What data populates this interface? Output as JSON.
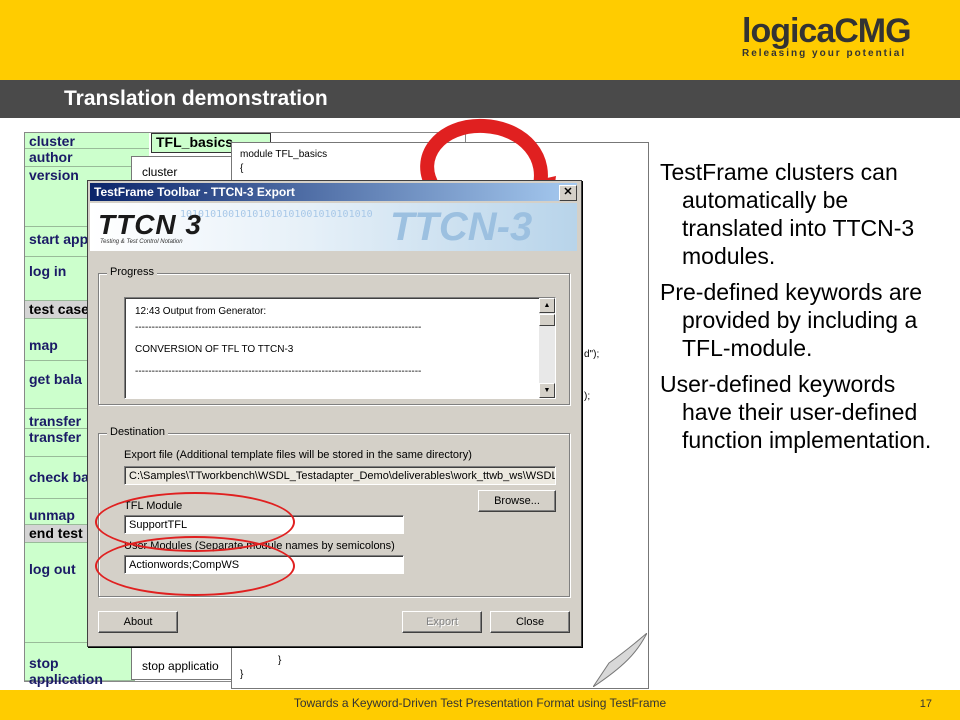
{
  "slide": {
    "title": "Translation demonstration",
    "footer": "Towards a Keyword-Driven Test Presentation Format using TestFrame",
    "page_number": "17",
    "logo": {
      "word": "logicaCMG",
      "tagline": "Releasing your potential"
    }
  },
  "bullets": [
    "TestFrame clusters can automatically be translated into TTCN-3 modules.",
    "Pre-defined keywords are provided by including a TFL-module.",
    "User-defined keywords have their user-defined function implementation."
  ],
  "spreadsheet": {
    "header_cell": "TFL_basics",
    "rows": [
      {
        "label": "cluster",
        "style": "green"
      },
      {
        "label": "author",
        "style": "green"
      },
      {
        "label": "version",
        "style": "green"
      },
      {
        "label": "start appl",
        "style": "green"
      },
      {
        "label": "log in",
        "style": "green"
      },
      {
        "label": "test case",
        "style": "gray"
      },
      {
        "label": "map",
        "style": "green"
      },
      {
        "label": "get bala",
        "style": "green"
      },
      {
        "label": "transfer",
        "style": "green"
      },
      {
        "label": "transfer",
        "style": "green"
      },
      {
        "label": "check ba",
        "style": "green"
      },
      {
        "label": "unmap",
        "style": "green"
      },
      {
        "label": "end test",
        "style": "gray"
      },
      {
        "label": "log out",
        "style": "green"
      },
      {
        "label": "stop application",
        "style": "green"
      }
    ]
  },
  "doc1": {
    "top": "cluster",
    "bottom": "stop applicatio"
  },
  "doc2": {
    "module": "module TFL_basics",
    "brace": "{",
    "frag1": "d\");",
    "frag2": ");",
    "end_inner": "}",
    "end_outer": "}"
  },
  "dialog": {
    "title": "TestFrame Toolbar - TTCN-3 Export",
    "close_glyph": "✕",
    "banner": {
      "logo": "TTCN 3",
      "subtitle": "Testing & Test Control Notation",
      "bits": "10101010010101010101001010101010",
      "watermark": "TTCN-3"
    },
    "progress": {
      "label": "Progress",
      "lines": [
        "12:43  Output from Generator:",
        "--------------------------------------------------------------------------------------",
        "CONVERSION OF TFL TO TTCN-3",
        "--------------------------------------------------------------------------------------"
      ]
    },
    "destination": {
      "label": "Destination",
      "export_label": "Export file (Additional template files will be stored in the same directory)",
      "export_value": "C:\\Samples\\TTworkbench\\WSDL_Testadapter_Demo\\deliverables\\work_ttwb_ws\\WSDL",
      "browse": "Browse...",
      "tfl_label": "TFL Module",
      "tfl_value": "SupportTFL",
      "user_label": "User Modules (Separate module names by semicolons)",
      "user_value": "Actionwords;CompWS"
    },
    "buttons": {
      "about": "About",
      "export": "Export",
      "close": "Close"
    }
  },
  "colors": {
    "accent": "#ffcc00",
    "title_bar": "#4a4a4a",
    "annotation": "#e02020"
  }
}
